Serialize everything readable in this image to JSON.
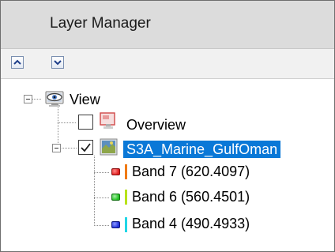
{
  "panel": {
    "title": "Layer Manager"
  },
  "toolbar": {
    "buttons": [
      {
        "icon": "chevron-up-icon"
      },
      {
        "icon": "chevron-down-icon"
      }
    ]
  },
  "tree": {
    "root": {
      "label": "View",
      "icon": "eye-on-monitor-icon",
      "expanded": true
    },
    "overview": {
      "label": "Overview",
      "icon": "overview-image-icon",
      "checked": false
    },
    "layer": {
      "label": "S3A_Marine_GulfOman",
      "icon": "raster-image-icon",
      "checked": true,
      "selected": true,
      "expanded": true
    },
    "bands": [
      {
        "label": "Band 7 (620.4097)",
        "color": "#e01f1f",
        "bar_color": "#f07a14"
      },
      {
        "label": "Band 6 (560.4501)",
        "color": "#22c022",
        "bar_color": "#b7e21a"
      },
      {
        "label": "Band 4 (490.4933)",
        "color": "#2030d8",
        "bar_color": "#20d6e6"
      }
    ]
  },
  "colors": {
    "selection": "#0a78d7",
    "title_bar": "#dcdcdc"
  }
}
